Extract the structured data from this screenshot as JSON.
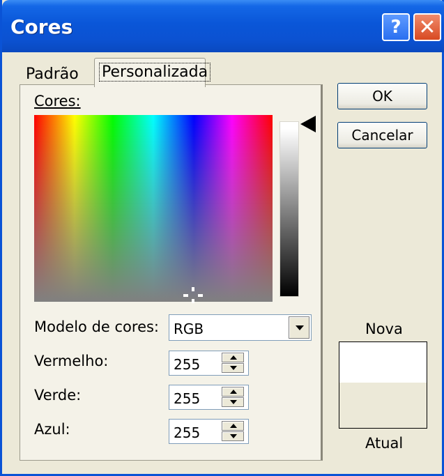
{
  "window": {
    "title": "Cores",
    "help_glyph": "?",
    "close_glyph": "✕"
  },
  "tabs": [
    {
      "label": "Padrão",
      "selected": false
    },
    {
      "label": "Personalizada",
      "selected": true
    }
  ],
  "colors_label": "Cores:",
  "model": {
    "label": "Modelo de cores:",
    "value": "RGB"
  },
  "fields": [
    {
      "label": "Vermelho:",
      "value": "255"
    },
    {
      "label": "Verde:",
      "value": "255"
    },
    {
      "label": "Azul:",
      "value": "255"
    }
  ],
  "buttons": {
    "ok": "OK",
    "cancel": "Cancelar"
  },
  "preview": {
    "new_label": "Nova",
    "current_label": "Atual",
    "new_color": "#ffffff",
    "current_color": "#ece9d8"
  },
  "colors": {
    "title_bar": "#0a56d8",
    "dialog_bg": "#ece9d8"
  }
}
